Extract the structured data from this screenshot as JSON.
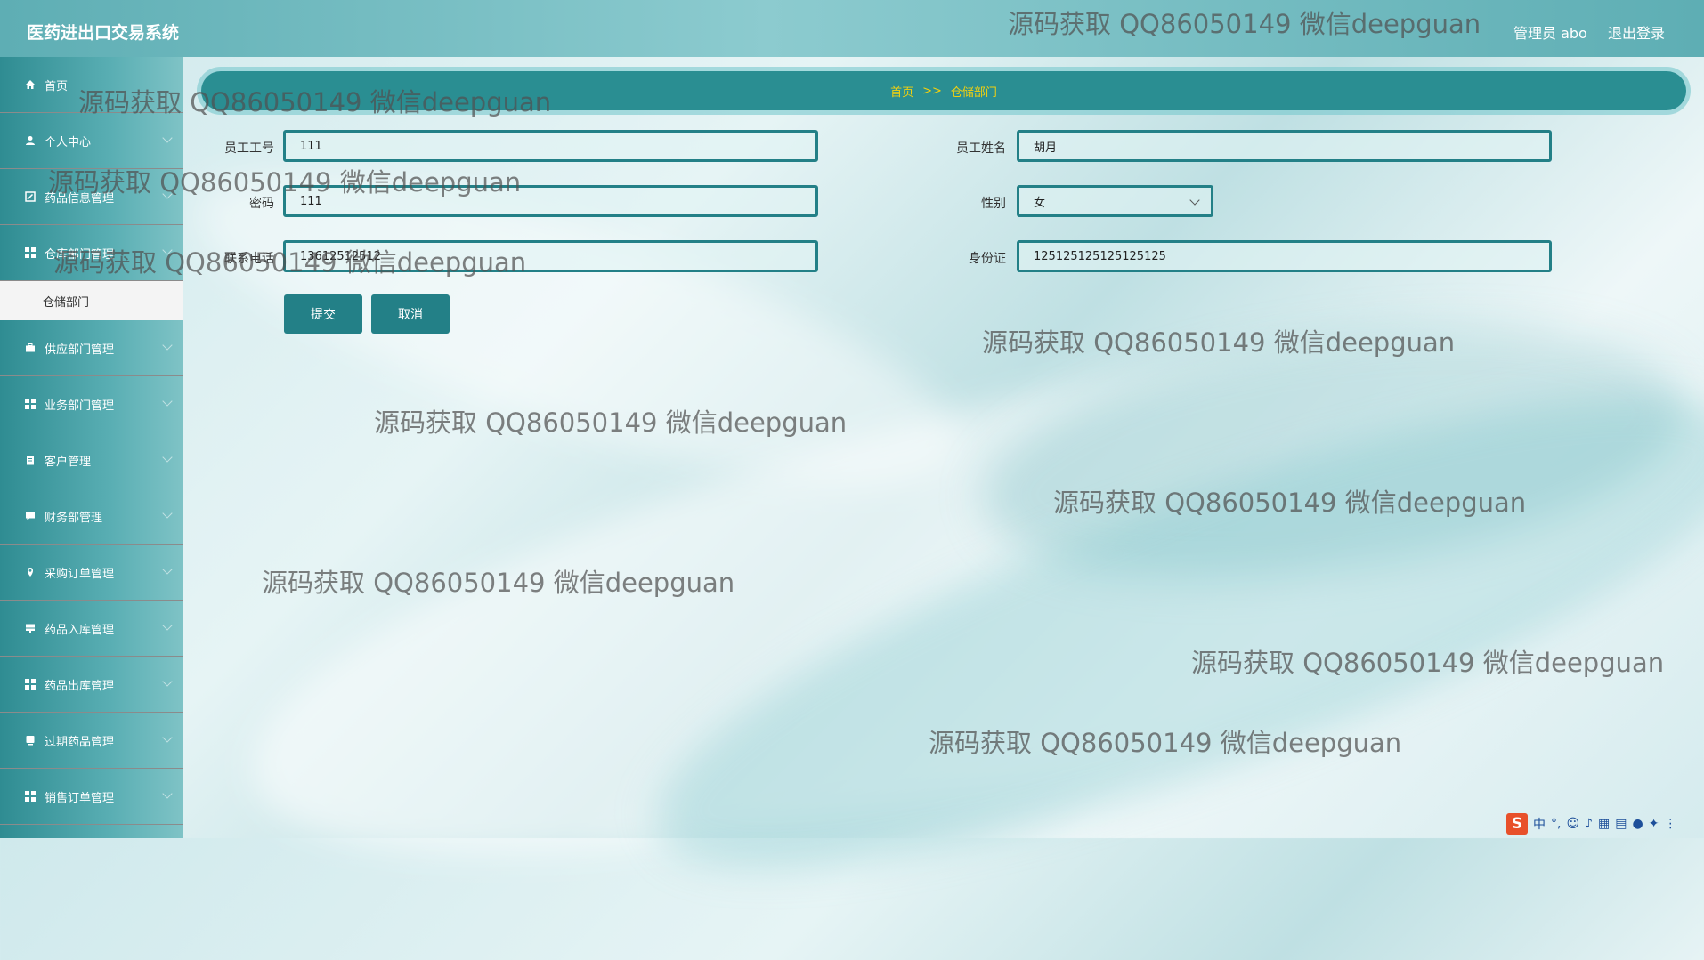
{
  "header": {
    "title": "医药进出口交易系统",
    "user": "管理员 abo",
    "logout": "退出登录"
  },
  "sidebar": {
    "items": [
      {
        "label": "首页",
        "icon": "home-icon"
      },
      {
        "label": "个人中心",
        "icon": "user-icon"
      },
      {
        "label": "药品信息管理",
        "icon": "edit-icon"
      },
      {
        "label": "仓库部门管理",
        "icon": "grid-icon"
      },
      {
        "label": "供应部门管理",
        "icon": "briefcase-icon"
      },
      {
        "label": "业务部门管理",
        "icon": "grid-icon"
      },
      {
        "label": "客户管理",
        "icon": "clipboard-icon"
      },
      {
        "label": "财务部管理",
        "icon": "comment-icon"
      },
      {
        "label": "采购订单管理",
        "icon": "location-icon"
      },
      {
        "label": "药品入库管理",
        "icon": "server-icon"
      },
      {
        "label": "药品出库管理",
        "icon": "grid-icon"
      },
      {
        "label": "过期药品管理",
        "icon": "drive-icon"
      },
      {
        "label": "销售订单管理",
        "icon": "grid-icon"
      }
    ],
    "active_sub": "仓储部门"
  },
  "breadcrumb": {
    "home": "首页",
    "sep": ">>",
    "current": "仓储部门"
  },
  "form": {
    "emp_no": {
      "label": "员工工号",
      "value": "111"
    },
    "emp_name": {
      "label": "员工姓名",
      "value": "胡月"
    },
    "password": {
      "label": "密码",
      "value": "111"
    },
    "gender": {
      "label": "性别",
      "value": "女"
    },
    "phone": {
      "label": "联系电话",
      "value": "13612512512"
    },
    "id_card": {
      "label": "身份证",
      "value": "125125125125125125"
    },
    "submit": "提交",
    "cancel": "取消"
  },
  "watermark": "源码获取 QQ86050149 微信deepguan",
  "ime": {
    "logo": "S",
    "mode": "中"
  }
}
